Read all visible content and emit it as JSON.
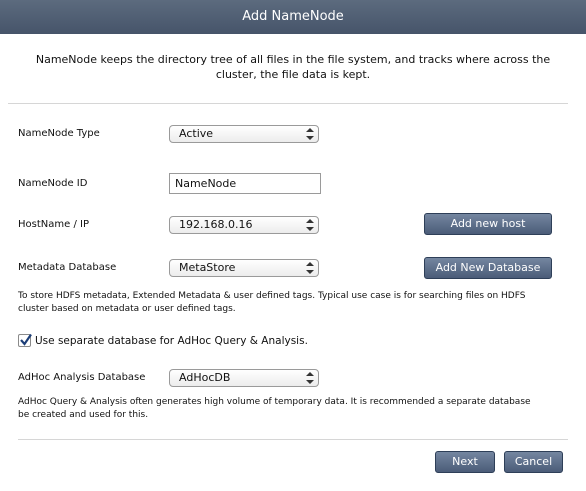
{
  "dialog": {
    "title": "Add NameNode",
    "intro": "NameNode keeps the directory tree of all files in the file system, and tracks where across the cluster, the file data is kept."
  },
  "form": {
    "namenode_type": {
      "label": "NameNode Type",
      "value": "Active"
    },
    "namenode_id": {
      "label": "NameNode ID",
      "value": "NameNode"
    },
    "host": {
      "label": "HostName / IP",
      "value": "192.168.0.16",
      "button": "Add new host"
    },
    "metadata_db": {
      "label": "Metadata Database",
      "value": "MetaStore",
      "button": "Add New Database",
      "help": "To store HDFS metadata, Extended Metadata & user defined tags. Typical use case is for searching files on HDFS cluster based on metadata or user defined tags."
    },
    "separate_db": {
      "label": "Use separate database for AdHoc Query & Analysis.",
      "checked": true
    },
    "adhoc_db": {
      "label": "AdHoc Analysis Database",
      "value": "AdHocDB",
      "help": "AdHoc Query & Analysis often generates high volume of temporary data. It is recommended a separate database be created and used for this."
    }
  },
  "footer": {
    "next": "Next",
    "cancel": "Cancel"
  },
  "colors": {
    "title_bar": "#4f5d73",
    "button": "#5a6b86"
  }
}
